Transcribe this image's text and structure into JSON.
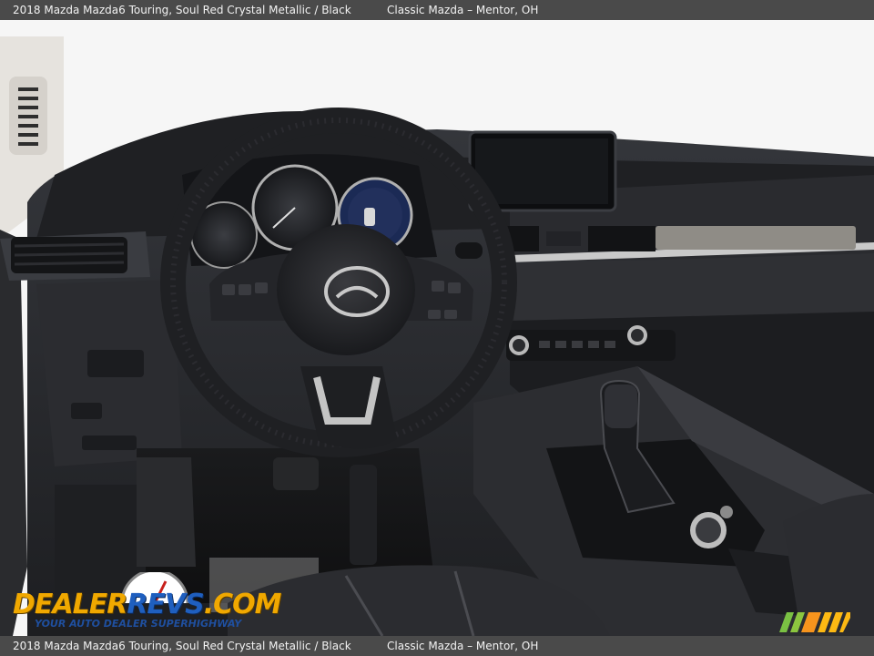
{
  "caption": {
    "vehicle": "2018 Mazda Mazda6 Touring,  Soul Red Crystal Metallic / Black",
    "dealer": "Classic Mazda – Mentor, OH"
  },
  "watermark": {
    "brand_part1": "DEALER",
    "brand_part2": "REVS",
    "brand_part3": ".COM",
    "tagline": "YOUR AUTO DEALER SUPERHIGHWAY"
  },
  "photo": {
    "subject": "steering-wheel-and-dashboard",
    "colors": {
      "interior": "#2b2c30",
      "dash_dark": "#1c1d20",
      "trim": "#b9b9b9",
      "window": "#f4f4f4",
      "exterior_red": "#b8221f"
    }
  }
}
